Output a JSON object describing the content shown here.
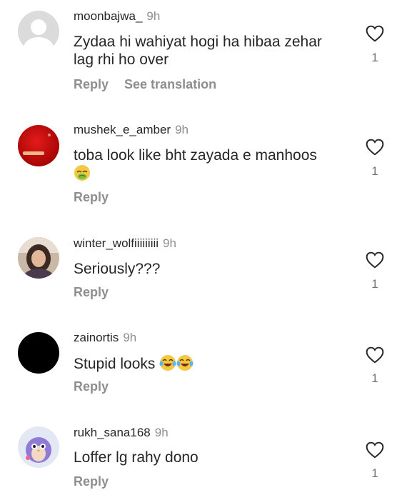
{
  "comments": [
    {
      "username": "moonbajwa_",
      "time": "9h",
      "text": "Zydaa hi wahiyat hogi ha hibaa zehar lag rhi ho over",
      "reply_label": "Reply",
      "translation_label": "See translation",
      "likes": "1",
      "avatar": "default-avatar"
    },
    {
      "username": "mushek_e_amber",
      "time": "9h",
      "text": "toba look like bht zayada e manhoos",
      "emoji": "nauseated-face",
      "reply_label": "Reply",
      "likes": "1",
      "avatar": "red-avatar"
    },
    {
      "username": "winter_wolfiiiiiiiii",
      "time": "9h",
      "text": "Seriously???",
      "reply_label": "Reply",
      "likes": "1",
      "avatar": "photo-avatar"
    },
    {
      "username": "zainortis",
      "time": "9h",
      "text": "Stupid looks",
      "emoji": "laughing-crying-face x2",
      "reply_label": "Reply",
      "likes": "1",
      "avatar": "black-avatar"
    },
    {
      "username": "rukh_sana168",
      "time": "9h",
      "text": "Loffer lg rahy dono",
      "reply_label": "Reply",
      "likes": "1",
      "avatar": "cartoon-bird-avatar"
    }
  ],
  "colors": {
    "text": "#262626",
    "muted": "#8e8e8e",
    "background": "#ffffff"
  }
}
